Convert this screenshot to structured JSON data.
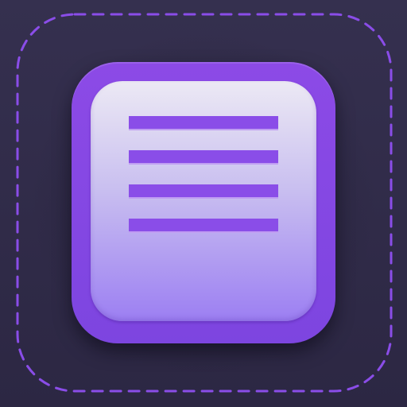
{
  "icon": {
    "name": "document-lines-icon",
    "line_count": 4
  },
  "colors": {
    "background": "#2c2743",
    "frame_dash": "#8a4de8",
    "tile_border": "#8347e3",
    "face_top": "#ece9f4",
    "face_bottom": "#9c7ff2",
    "lines": "#8a4de8"
  }
}
